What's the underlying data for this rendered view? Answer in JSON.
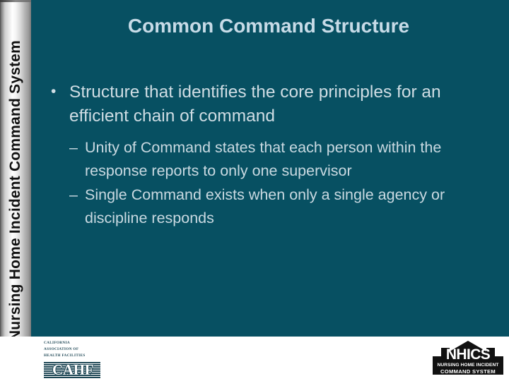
{
  "colors": {
    "panel_teal": "#075062",
    "title_text": "#c7dbe7",
    "body_text": "#cfdde4",
    "sub_text": "#c9d9e1",
    "footer_bg": "#ffffff",
    "logo_dark": "#1d4654",
    "sidebar_text": "#111111"
  },
  "sidebar": {
    "label": "Nursing Home Incident Command System"
  },
  "slide": {
    "title": "Common Command Structure",
    "bullets": [
      {
        "marker": "•",
        "text": "Structure that identifies the core principles for an efficient chain of command",
        "sub_bullets": [
          {
            "marker": "–",
            "text": "Unity of Command states that each person within the response reports to only one supervisor"
          },
          {
            "marker": "–",
            "text": "Single Command exists when only a single agency or discipline responds"
          }
        ]
      }
    ]
  },
  "footer": {
    "cahf_logo": {
      "line1": "California",
      "line2": "Association of",
      "line3": "Health Facilities",
      "wordmark": "CAHF"
    },
    "nhics_logo": {
      "wordmark": "NHICS",
      "sub1": "NURSING HOME INCIDENT",
      "sub2": "COMMAND SYSTEM"
    }
  }
}
